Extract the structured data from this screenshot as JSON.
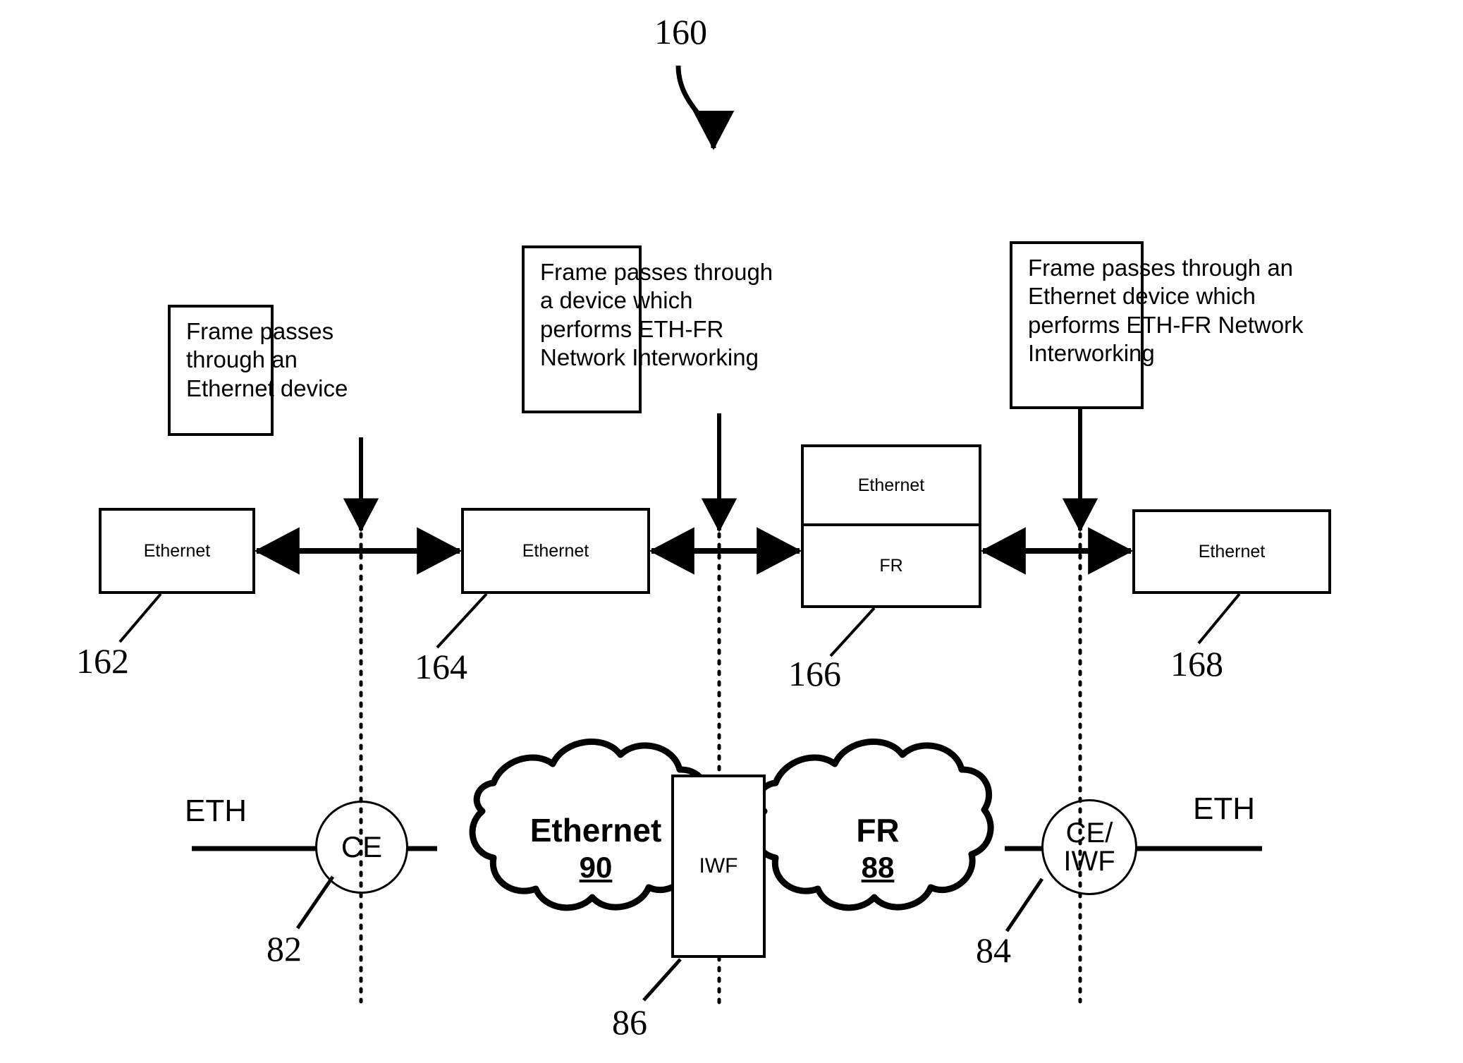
{
  "figure": {
    "number": "160"
  },
  "callouts": [
    {
      "id": "callout-ethernet-device",
      "lines": [
        "Frame passes",
        "through an",
        "Ethernet device"
      ]
    },
    {
      "id": "callout-eth-fr-interworking",
      "lines": [
        "Frame passes through",
        "a device which",
        "performs ETH-FR",
        "Network Interworking"
      ]
    },
    {
      "id": "callout-ethernet-eth-fr-interworking",
      "lines": [
        "Frame passes through an",
        "Ethernet device which",
        "performs ETH-FR Network",
        "Interworking"
      ]
    }
  ],
  "frames": [
    {
      "id": "frame-162",
      "label": "Ethernet",
      "ref": "162"
    },
    {
      "id": "frame-164",
      "label": "Ethernet",
      "ref": "164"
    },
    {
      "id": "frame-166",
      "label_top": "Ethernet",
      "label_bottom": "FR",
      "ref": "166"
    },
    {
      "id": "frame-168",
      "label": "Ethernet",
      "ref": "168"
    }
  ],
  "network": {
    "left_interface_label": "ETH",
    "right_interface_label": "ETH",
    "ce_node": {
      "label": "CE",
      "ref": "82"
    },
    "ce_iwf_node": {
      "line1": "CE/",
      "line2": "IWF",
      "ref": "84"
    },
    "ethernet_cloud": {
      "name": "Ethernet",
      "num": "90"
    },
    "fr_cloud": {
      "name": "FR",
      "num": "88"
    },
    "iwf_box": {
      "label": "IWF",
      "ref": "86"
    }
  },
  "colors": {
    "ink": "#000000",
    "paper": "#ffffff"
  }
}
